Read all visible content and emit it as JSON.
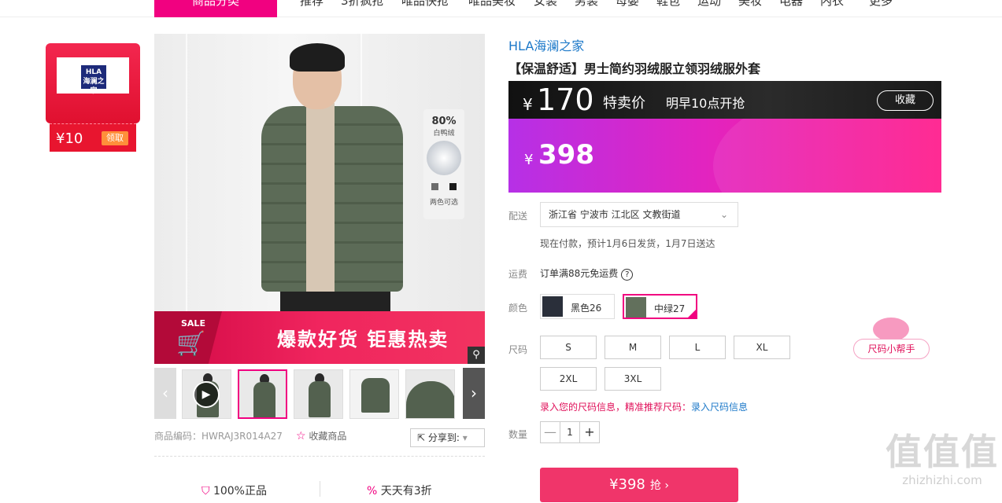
{
  "nav": {
    "category_label": "商品分类",
    "items": [
      "推荐",
      "3折疯抢",
      "唯品快抢",
      "唯品美妆",
      "女装",
      "男装",
      "母婴",
      "鞋包",
      "运动",
      "美妆",
      "电器",
      "内衣",
      "更多"
    ]
  },
  "coupon": {
    "logo_text": "HLA 海澜之家",
    "amount": "¥10",
    "action": "领取"
  },
  "gallery": {
    "badge_pct": "80%",
    "badge_sub": "白鸭绒",
    "badge_colors": "两色可选",
    "sale_tag": "SALE",
    "promo_text": "爆款好货 钜惠热卖",
    "zoom_icon": "search-icon"
  },
  "meta": {
    "sku": "商品编码：HWRAJ3R014A27",
    "fav": "收藏商品",
    "share": "分享到:"
  },
  "guarantees": [
    "100%正品",
    "天天有3折"
  ],
  "product": {
    "brand": "HLA海澜之家",
    "title": "【保温舒适】男士简约羽绒服立领羽绒服外套",
    "price_symbol": "¥",
    "sale_price": "170",
    "sale_label": "特卖价",
    "start_text": "明早10点开抢",
    "fav_label": "收藏",
    "orig_price": "398"
  },
  "delivery": {
    "label": "配送",
    "address": "浙江省 宁波市 江北区 文教街道",
    "eta": "现在付款，预计1月6日发货，1月7日送达"
  },
  "shipping": {
    "label": "运费",
    "text": "订单满88元免运费",
    "help": "?"
  },
  "colors": {
    "label": "颜色",
    "options": [
      {
        "name": "黑色26",
        "selected": false
      },
      {
        "name": "中绿27",
        "selected": true
      }
    ]
  },
  "sizes": {
    "label": "尺码",
    "options": [
      "S",
      "M",
      "L",
      "XL",
      "2XL",
      "3XL"
    ],
    "tip": "录入您的尺码信息，精准推荐尺码：",
    "tip_link": "录入尺码信息",
    "helper": "尺码小帮手"
  },
  "quantity": {
    "label": "数量",
    "value": "1",
    "minus": "—",
    "plus": "+"
  },
  "buy": {
    "label": "¥398",
    "action": "抢 ›"
  },
  "watermark": {
    "big": "值值值",
    "small": "zhizhizhi.com"
  },
  "colors_theme": {
    "accent": "#f10180",
    "brand_blue": "#1d79c9",
    "buy": "#f0356a"
  }
}
